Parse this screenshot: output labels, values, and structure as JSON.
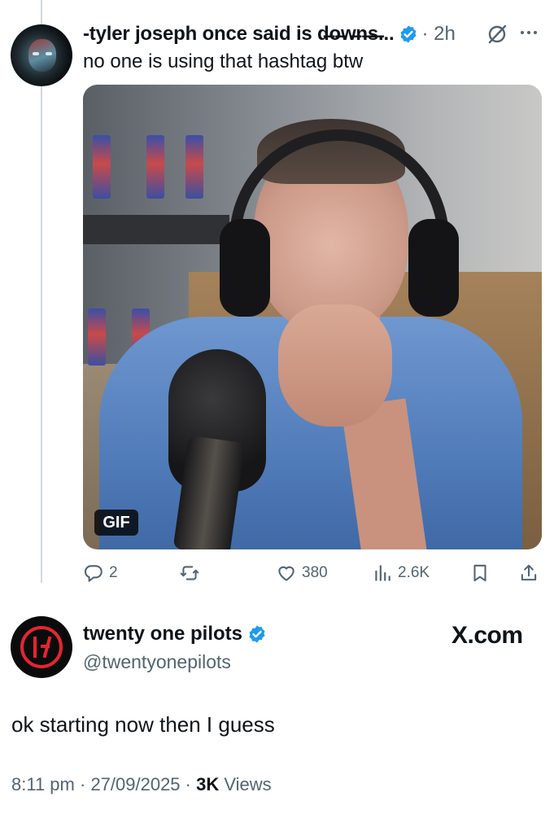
{
  "quoted_tweet": {
    "display_name": "-tyler joseph once said is d̶o̶w̶n̶s̶...",
    "time": "· 2h",
    "text": "no one is using that hashtag btw",
    "media_badge": "GIF",
    "actions": {
      "replies": "2",
      "retweets": "",
      "likes": "380",
      "views": "2.6K"
    }
  },
  "main_tweet": {
    "display_name": "twenty one pilots",
    "handle": "@twentyonepilots",
    "text": "ok starting now then I guess",
    "time": "8:11 pm",
    "date": "27/09/2025",
    "views_count": "3K",
    "views_label": "Views"
  },
  "watermark": "X.com",
  "colors": {
    "verified_blue": "#1d9bf0",
    "muted_text": "#536471",
    "primary_text": "#0f1419",
    "top_logo_red": "#e3262f"
  }
}
